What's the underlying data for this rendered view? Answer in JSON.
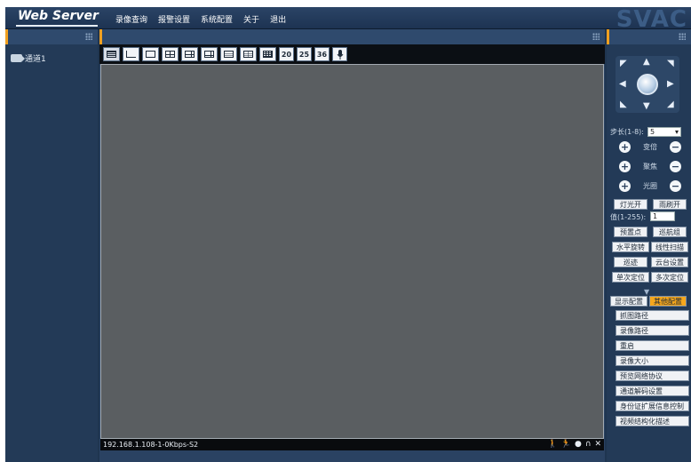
{
  "header": {
    "logo": "Web Server",
    "brand": "SVAC",
    "menu": [
      "录像查询",
      "报警设置",
      "系统配置",
      "关于",
      "退出"
    ]
  },
  "left": {
    "channel": "通道1"
  },
  "toolbar": {
    "numeric_layouts": [
      "20",
      "25",
      "36"
    ]
  },
  "status": {
    "text": "192.168.1.108-1-0Kbps-S2"
  },
  "ptz": {
    "step_label": "步长(1-8):",
    "step_value": "5",
    "zoom_label": "变倍",
    "focus_label": "聚焦",
    "iris_label": "光圈",
    "light_on": "灯光开",
    "wiper_on": "雨刷开",
    "value_label": "值(1-255):",
    "value": "1",
    "preset": "预置点",
    "cruise_group": "巡航组",
    "horizontal_rotate": "水平旋转",
    "line_scan": "线性扫描",
    "patrol": "巡迹",
    "ptz_settings": "云台设置",
    "single_position": "单次定位",
    "multi_position": "多次定位"
  },
  "config": {
    "tab_display": "显示配置",
    "tab_other": "其他配置",
    "items": [
      "抓图路径",
      "录像路径",
      "重启",
      "录像大小",
      "预览网络协议",
      "通道解码设置",
      "身份证扩展信息控制",
      "视频结构化描述"
    ]
  },
  "colors": {
    "accent": "#f0a020",
    "active_tab": "#f6a71c",
    "background": "#1f3550"
  }
}
